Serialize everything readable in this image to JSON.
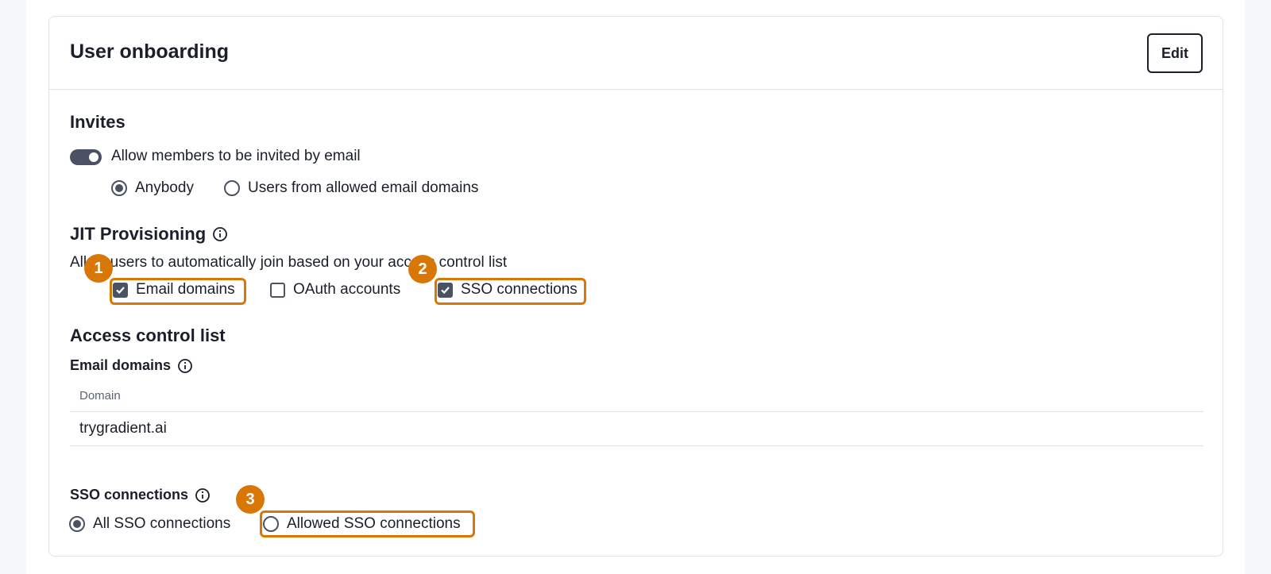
{
  "card": {
    "title": "User onboarding",
    "edit_label": "Edit"
  },
  "invites": {
    "heading": "Invites",
    "toggle_label": "Allow members to be invited by email",
    "toggle_on": true,
    "options": [
      {
        "label": "Anybody",
        "selected": true
      },
      {
        "label": "Users from allowed email domains",
        "selected": false
      }
    ]
  },
  "jit": {
    "heading": "JIT Provisioning",
    "description": "Allow users to automatically join based on your access control list",
    "options": [
      {
        "label": "Email domains",
        "checked": true
      },
      {
        "label": "OAuth accounts",
        "checked": false
      },
      {
        "label": "SSO connections",
        "checked": true
      }
    ]
  },
  "acl": {
    "heading": "Access control list",
    "email_domains": {
      "label": "Email domains",
      "column": "Domain",
      "rows": [
        "trygradient.ai"
      ]
    },
    "sso": {
      "label": "SSO connections",
      "options": [
        {
          "label": "All SSO connections",
          "selected": true
        },
        {
          "label": "Allowed SSO connections",
          "selected": false
        }
      ]
    }
  },
  "annotations": [
    "1",
    "2",
    "3"
  ],
  "colors": {
    "accent": "#d97706",
    "control": "#4a5263",
    "text": "#1b1f2a",
    "border": "#dfe2e7"
  }
}
